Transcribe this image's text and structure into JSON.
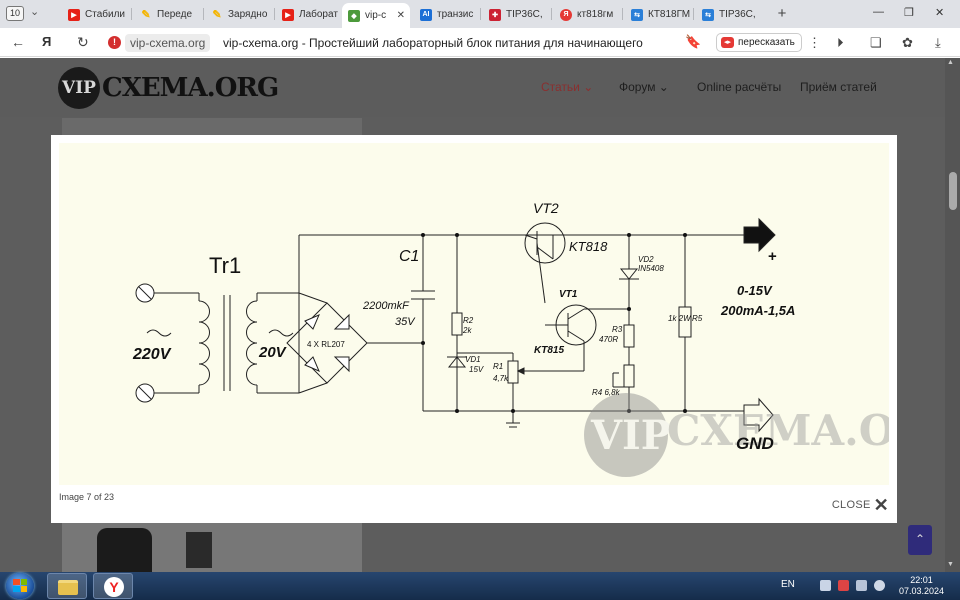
{
  "browser": {
    "tab_counter": "10",
    "tabs": [
      {
        "label": "Стабили",
        "favicon": "youtube-icon",
        "color": "#e62117"
      },
      {
        "label": "Переде",
        "favicon": "pencil-icon",
        "color": "#f4b400"
      },
      {
        "label": "Зарядно",
        "favicon": "pencil-icon",
        "color": "#f4b400"
      },
      {
        "label": "Лаборат",
        "favicon": "youtube-icon",
        "color": "#e62117"
      },
      {
        "label": "vip-c",
        "favicon": "vip-cxema-icon",
        "color": "#4c9a3c",
        "active": true
      },
      {
        "label": "транзис",
        "favicon": "ai-icon",
        "color": "#1c6fd6"
      },
      {
        "label": "TIP36C,",
        "favicon": "cross-icon",
        "color": "#cc2233"
      },
      {
        "label": "кт818гм",
        "favicon": "yandex-icon",
        "color": "#e53935"
      },
      {
        "label": "КТ818ГМ",
        "favicon": "datasheet-icon",
        "color": "#2a7fd8"
      },
      {
        "label": "TIP36C,",
        "favicon": "datasheet-icon",
        "color": "#2a7fd8"
      }
    ],
    "address": {
      "domain": "vip-cxema.org",
      "title": "vip-cxema.org - Простейший лабораторный блок питания для начинающего"
    },
    "retell_label": "пересказать"
  },
  "site": {
    "logo_vip": "VIP",
    "logo_text": "CXEMA.ORG",
    "nav": [
      {
        "label": "Статьи",
        "dropdown": true,
        "active": true
      },
      {
        "label": "Форум",
        "dropdown": true,
        "active": false
      },
      {
        "label": "Online расчёты",
        "dropdown": false,
        "active": false
      },
      {
        "label": "Приём статей",
        "dropdown": false,
        "active": false
      }
    ]
  },
  "lightbox": {
    "counter": "Image 7 of 23",
    "close_label": "CLOSE"
  },
  "schematic": {
    "tr1": "Tr1",
    "in_voltage": "220V",
    "sec_voltage": "20V",
    "bridge": "4 X RL207",
    "c1": "C1",
    "c1_value": "2200mkF",
    "c1_voltage": "35V",
    "vt2": "VT2",
    "vt2_type": "KT818",
    "vt1": "VT1",
    "vt1_type": "KT815",
    "vd2": "VD2",
    "vd2_type": "IN5408",
    "vd1": "VD1",
    "vd1_type": "15V",
    "r2": "R2",
    "r2_value": "2k",
    "r1": "R1",
    "r1_value": "4,7k",
    "r3": "R3",
    "r3_value": "470R",
    "r4": "R4 6,8k",
    "r5": "R5",
    "r5_value": "1k 2W",
    "out_range": "0-15V",
    "out_current": "200mA-1,5A",
    "gnd": "GND",
    "plus": "+",
    "watermark_vip": "VIP",
    "watermark_text": "CXEMA.ORG"
  },
  "taskbar": {
    "lang": "EN",
    "time": "22:01",
    "date": "07.03.2024"
  }
}
